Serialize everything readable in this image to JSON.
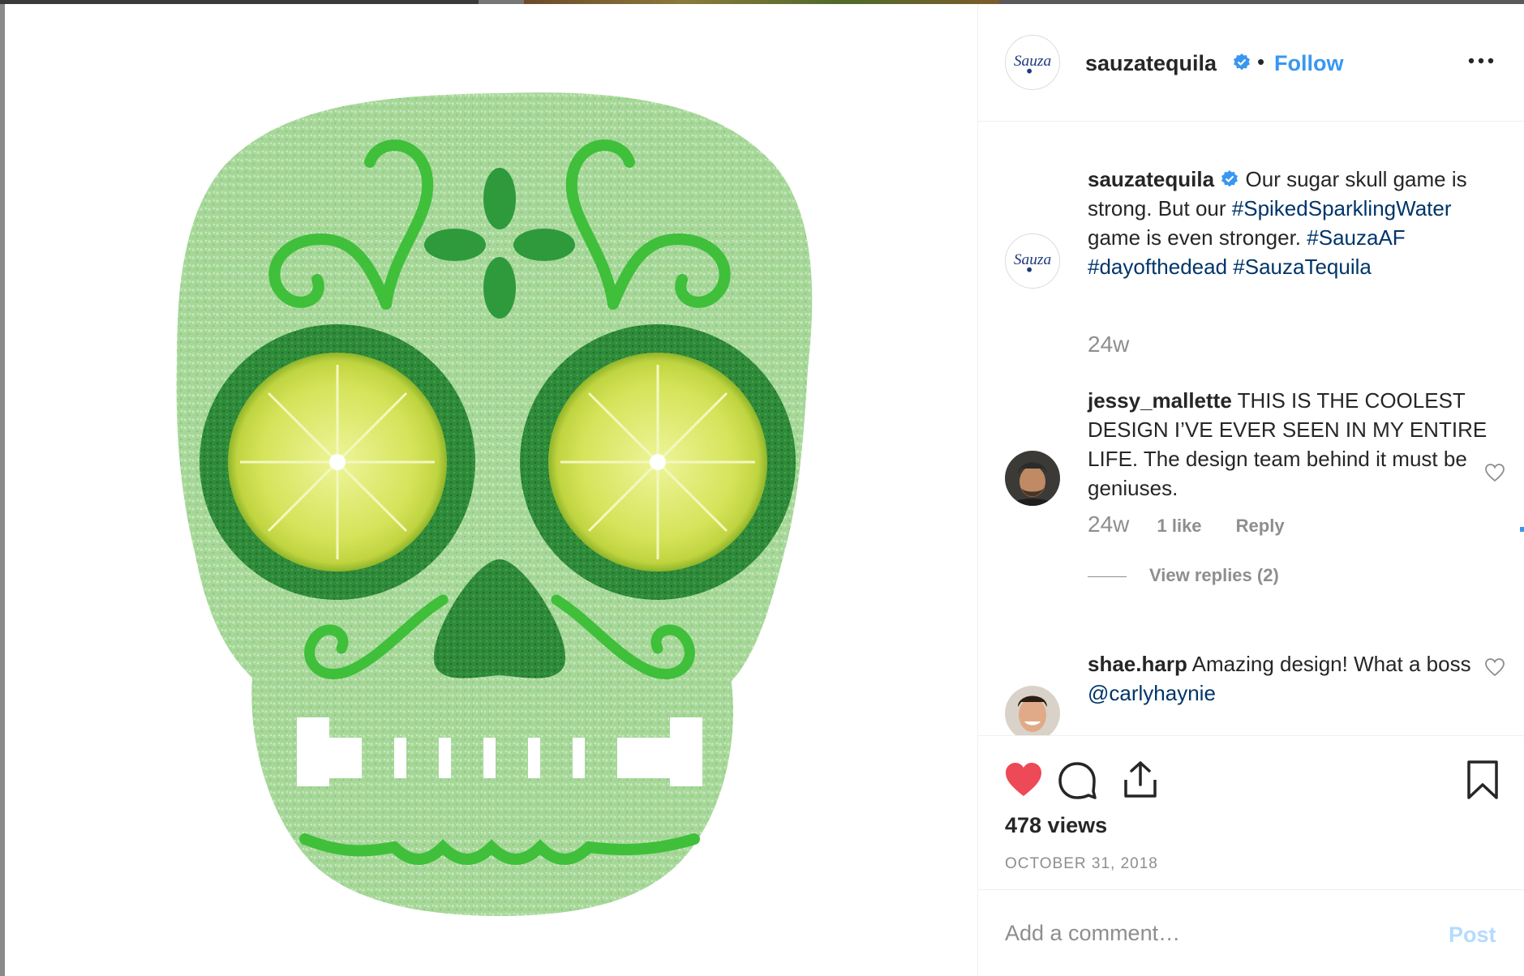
{
  "post": {
    "account": "sauzatequila",
    "follow_label": "Follow",
    "separator": "•",
    "logo_text": "Sauza",
    "media_alt": "Green sugar skull made of sugar crystals with lime slice eyes"
  },
  "caption": {
    "username": "sauzatequila",
    "text": "Our sugar skull game is strong. But our ",
    "hashtag1": "#SpikedSparklingWater",
    "text2": " game is even stronger. ",
    "hashtag2": "#SauzaAF",
    "hashtag3": "#dayofthedead",
    "hashtag4": "#SauzaTequila",
    "time": "24w"
  },
  "comments": [
    {
      "username": "jessy_mallette",
      "text": "THIS IS THE COOLEST DESIGN I’VE EVER SEEN IN MY ENTIRE LIFE. The design team behind it must be geniuses.",
      "time": "24w",
      "likes": "1 like",
      "reply": "Reply",
      "view_replies": "View replies (2)"
    },
    {
      "username": "shae.harp",
      "text": "Amazing design! What a boss ",
      "mention": "@carlyhaynie"
    }
  ],
  "stats": {
    "views": "478 views",
    "date": "OCTOBER 31, 2018"
  },
  "comment_box": {
    "placeholder": "Add a comment…",
    "post_label": "Post"
  },
  "icons": {
    "like": "heart-filled-icon",
    "comment": "comment-bubble-icon",
    "share": "share-icon",
    "save": "bookmark-icon",
    "more": "more-options-icon",
    "verified": "verified-badge-icon"
  },
  "colors": {
    "link_blue": "#3897f0",
    "hashtag_blue": "#003569",
    "like_red": "#ed4956",
    "muted_gray": "#8e8e8e",
    "post_disabled": "#b3dbff"
  }
}
